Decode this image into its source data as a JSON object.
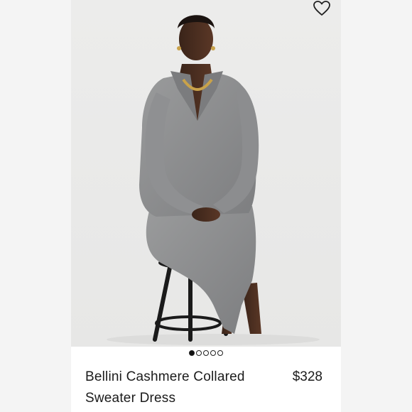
{
  "product": {
    "name": "Bellini Cashmere Collared Sweater Dress",
    "price": "$328",
    "image_alt": "Model seated on a black stool wearing a grey ribbed cashmere collared sweater dress",
    "carousel": {
      "total": 5,
      "active_index": 0
    }
  },
  "icons": {
    "favorite": "heart-outline-icon"
  },
  "colors": {
    "background": "#f4f4f4",
    "card": "#ffffff",
    "text": "#1b1b1b",
    "dress": "#8a8b8c"
  }
}
